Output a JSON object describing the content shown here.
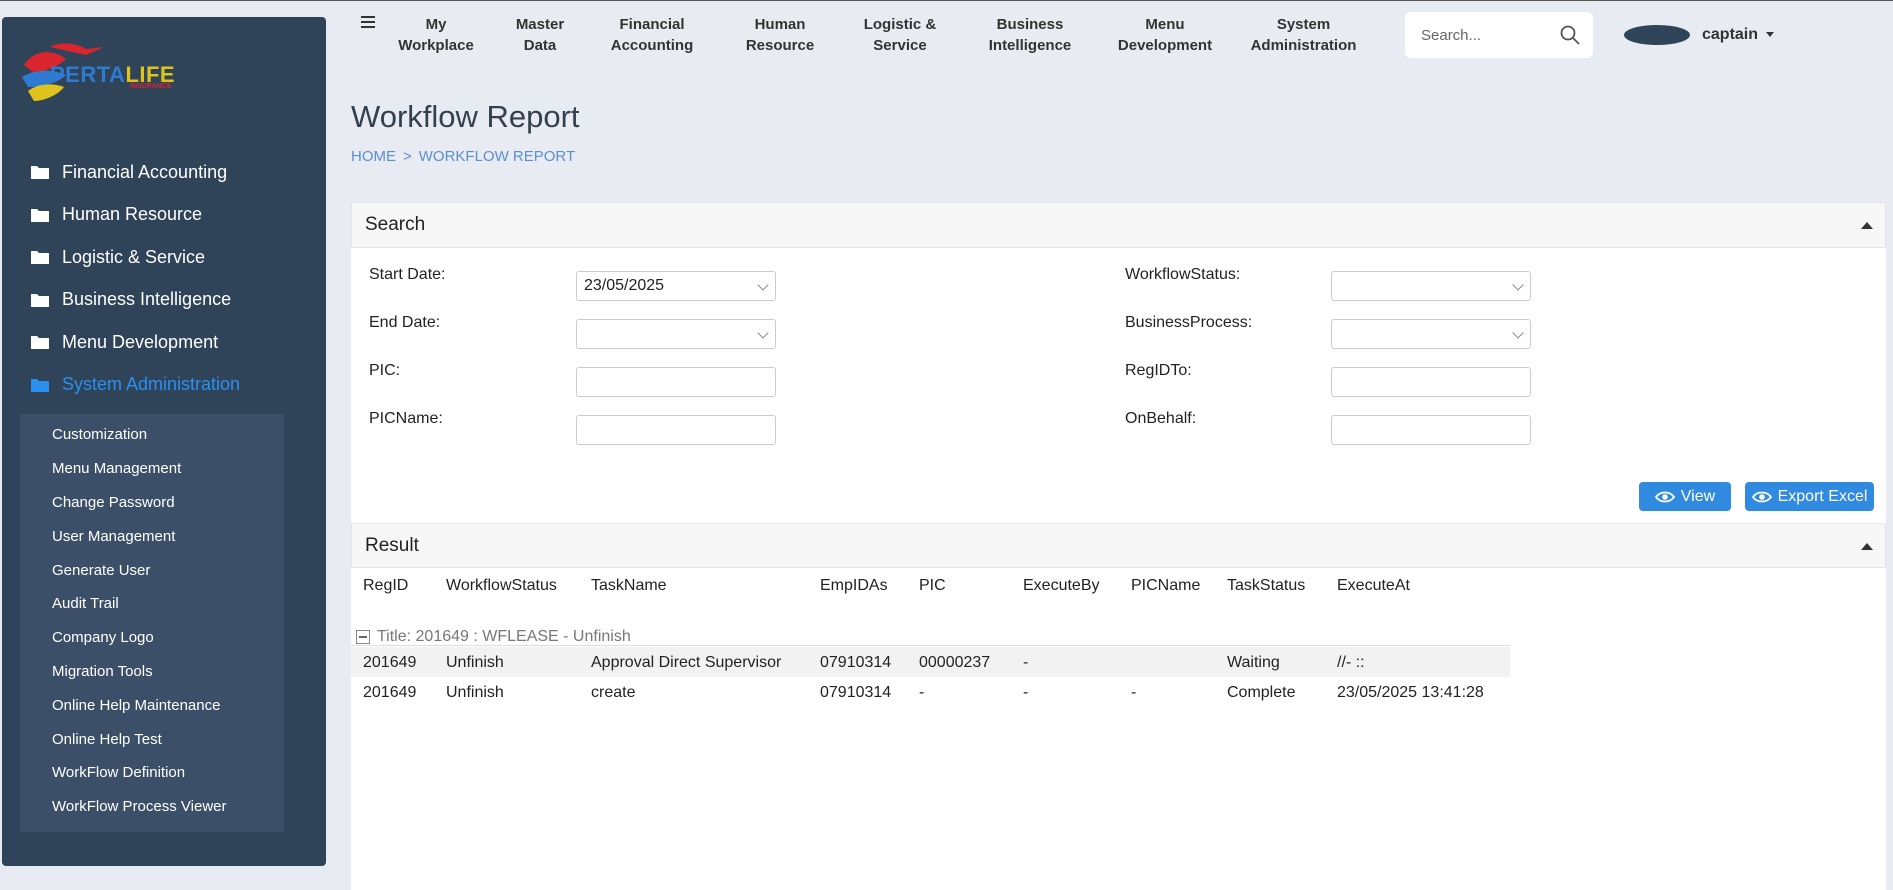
{
  "brand": {
    "name_part1": "PERTA",
    "name_part2": "LIFE",
    "tagline": "INSURANCE"
  },
  "sidebar": {
    "items": [
      {
        "label": "Financial Accounting",
        "active": false
      },
      {
        "label": "Human Resource",
        "active": false
      },
      {
        "label": "Logistic & Service",
        "active": false
      },
      {
        "label": "Business Intelligence",
        "active": false
      },
      {
        "label": "Menu Development",
        "active": false
      },
      {
        "label": "System Administration",
        "active": true
      }
    ],
    "submenu": [
      "Customization",
      "Menu Management",
      "Change Password",
      "User Management",
      "Generate User",
      "Audit Trail",
      "Company Logo",
      "Migration Tools",
      "Online Help Maintenance",
      "Online Help Test",
      "WorkFlow Definition",
      "WorkFlow Process Viewer"
    ]
  },
  "topnav": {
    "items": [
      {
        "label": "My\nWorkplace"
      },
      {
        "label": "Master\nData"
      },
      {
        "label": "Financial\nAccounting"
      },
      {
        "label": "Human\nResource"
      },
      {
        "label": "Logistic &\nService"
      },
      {
        "label": "Business\nIntelligence"
      },
      {
        "label": "Menu\nDevelopment"
      },
      {
        "label": "System\nAdministration"
      }
    ],
    "search_placeholder": "Search...",
    "username": "captain"
  },
  "page": {
    "title": "Workflow Report",
    "breadcrumb": {
      "home": "HOME",
      "separator": ">",
      "current": "WORKFLOW REPORT"
    }
  },
  "search_panel": {
    "title": "Search",
    "fields": {
      "start_date_label": "Start Date:",
      "start_date_value": "23/05/2025",
      "end_date_label": "End Date:",
      "end_date_value": "",
      "pic_label": "PIC:",
      "pic_value": "",
      "picname_label": "PICName:",
      "picname_value": "",
      "workflowstatus_label": "WorkflowStatus:",
      "workflowstatus_value": "",
      "businessprocess_label": "BusinessProcess:",
      "businessprocess_value": "",
      "regidto_label": "RegIDTo:",
      "regidto_value": "",
      "onbehalf_label": "OnBehalf:",
      "onbehalf_value": ""
    },
    "view_button": "View",
    "export_button": "Export Excel"
  },
  "result_panel": {
    "title": "Result",
    "columns": [
      "RegID",
      "WorkflowStatus",
      "TaskName",
      "EmpIDAs",
      "PIC",
      "ExecuteBy",
      "PICName",
      "TaskStatus",
      "ExecuteAt"
    ],
    "group_title": "Title: 201649 : WFLEASE - Unfinish",
    "rows": [
      [
        "201649",
        "Unfinish",
        "Approval Direct Supervisor",
        "07910314",
        "00000237",
        "-",
        "",
        "Waiting",
        "//- ::"
      ],
      [
        "201649",
        "Unfinish",
        "create",
        "07910314",
        "-",
        "-",
        "-",
        "Complete",
        "23/05/2025 13:41:28"
      ]
    ]
  },
  "colors": {
    "sidebar_bg": "#2f4459",
    "accent": "#2f8ae0",
    "page_bg": "#e9ebf3"
  }
}
